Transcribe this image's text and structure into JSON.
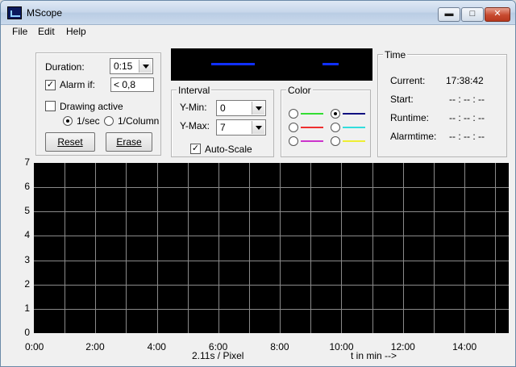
{
  "window": {
    "title": "MScope",
    "icon": "oscilloscope-icon"
  },
  "titlebar_buttons": {
    "minimize": "▬",
    "maximize": "□",
    "close": "✕"
  },
  "menu": [
    "File",
    "Edit",
    "Help"
  ],
  "settings": {
    "duration_label": "Duration:",
    "duration_value": "0:15",
    "alarm_label": "Alarm if:",
    "alarm_checked": "✓",
    "alarm_value": "< 0,8",
    "drawing_label": "Drawing active",
    "rate_per_sec": "1/sec",
    "rate_per_column": "1/Column",
    "reset_label": "Reset",
    "erase_label": "Erase"
  },
  "interval": {
    "legend": "Interval",
    "ymin_label": "Y-Min:",
    "ymin_value": "0",
    "ymax_label": "Y-Max:",
    "ymax_value": "7",
    "autoscale_label": "Auto-Scale",
    "autoscale_checked": "✓"
  },
  "color": {
    "legend": "Color",
    "swatches": [
      {
        "color": "#33dd33",
        "selected": false
      },
      {
        "color": "#101080",
        "selected": true
      },
      {
        "color": "#ee3030",
        "selected": false
      },
      {
        "color": "#33dddd",
        "selected": false
      },
      {
        "color": "#cc33cc",
        "selected": false
      },
      {
        "color": "#eeee33",
        "selected": false
      }
    ]
  },
  "time": {
    "legend": "Time",
    "current_label": "Current:",
    "current_value": "17:38:42",
    "start_label": "Start:",
    "start_value": "-- : -- : --",
    "runtime_label": "Runtime:",
    "runtime_value": "-- : -- : --",
    "alarmtime_label": "Alarmtime:",
    "alarmtime_value": "-- : -- : --"
  },
  "plot": {
    "y_ticks": [
      "7",
      "6",
      "5",
      "4",
      "3",
      "2",
      "1",
      "0"
    ],
    "x_ticks": [
      "0:00",
      "2:00",
      "4:00",
      "6:00",
      "8:00",
      "10:00",
      "12:00",
      "14:00"
    ],
    "resolution_label": "2.11s / Pixel",
    "x_axis_label": "t in min -->"
  }
}
